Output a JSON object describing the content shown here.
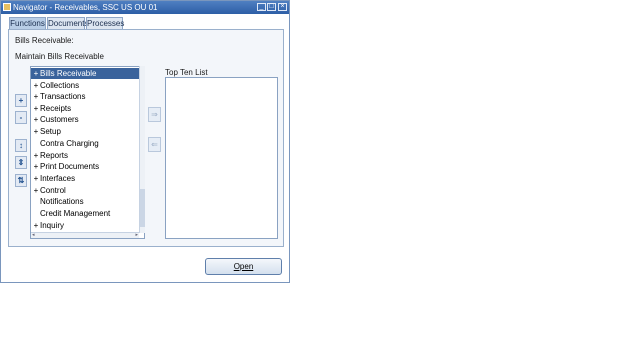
{
  "window": {
    "title": "Navigator - Receivables, SSC US OU 01",
    "minimize_glyph": "_",
    "maximize_glyph": "□",
    "close_glyph": "×"
  },
  "tabs": [
    {
      "label": "Functions",
      "active": true
    },
    {
      "label": "Documents",
      "active": false
    },
    {
      "label": "Processes",
      "active": false
    }
  ],
  "main": {
    "section_label": "Bills Receivable:",
    "subsection_label": "Maintain Bills Receivable",
    "top_ten_label": "Top Ten List"
  },
  "side_buttons": {
    "expand": "+",
    "collapse": "-",
    "expand_branch": "↕",
    "expand_all": "⇕",
    "collapse_all": "⇅"
  },
  "move_buttons": {
    "add": "⇒",
    "remove": "⇐"
  },
  "tree": [
    {
      "expander": "+",
      "label": "Bills Receivable",
      "selected": true
    },
    {
      "expander": "+",
      "label": "Collections"
    },
    {
      "expander": "+",
      "label": "Transactions"
    },
    {
      "expander": "+",
      "label": "Receipts"
    },
    {
      "expander": "+",
      "label": "Customers"
    },
    {
      "expander": "+",
      "label": "Setup"
    },
    {
      "expander": "",
      "label": "Contra Charging"
    },
    {
      "expander": "+",
      "label": "Reports"
    },
    {
      "expander": "+",
      "label": "Print Documents"
    },
    {
      "expander": "+",
      "label": "Interfaces"
    },
    {
      "expander": "+",
      "label": "Control"
    },
    {
      "expander": "",
      "label": "Notifications"
    },
    {
      "expander": "",
      "label": "Credit Management"
    },
    {
      "expander": "+",
      "label": "Inquiry"
    }
  ],
  "scroll": {
    "left_arrow": "◂",
    "right_arrow": "▸"
  },
  "open_button": "Open",
  "colors": {
    "title_bar": "#2d5ea6",
    "selection": "#3a639c"
  }
}
